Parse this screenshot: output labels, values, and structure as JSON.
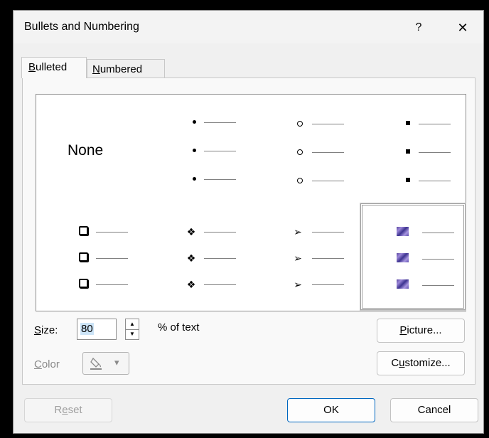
{
  "dialog": {
    "title": "Bullets and Numbering",
    "help_label": "?",
    "close_label": "✕"
  },
  "tabs": [
    {
      "label": "Bulleted",
      "accesskey": "B",
      "rest": "ulleted",
      "selected": true
    },
    {
      "label": "Numbered",
      "accesskey": "N",
      "rest": "umbered",
      "selected": false
    }
  ],
  "gallery": {
    "none_label": "None",
    "options": [
      {
        "id": "none",
        "glyph": ""
      },
      {
        "id": "dot",
        "glyph": "•"
      },
      {
        "id": "hollow-circle",
        "glyph": "○"
      },
      {
        "id": "filled-square",
        "glyph": "▪"
      },
      {
        "id": "hollow-square",
        "glyph": "❑"
      },
      {
        "id": "four-diamond",
        "glyph": "❖"
      },
      {
        "id": "arrowhead",
        "glyph": "➢"
      },
      {
        "id": "picture",
        "glyph": ""
      }
    ],
    "selected": "picture"
  },
  "size": {
    "label_accesskey": "S",
    "label_rest": "ize:",
    "value": "80",
    "suffix": "% of text"
  },
  "color": {
    "label_accesskey": "C",
    "label_rest": "olor",
    "icon": "paint-bucket-icon",
    "dropdown_icon": "chevron-down-icon",
    "arrow": "▾"
  },
  "buttons": {
    "picture_pre": "",
    "picture_key": "P",
    "picture_rest": "icture...",
    "customize_pre": "C",
    "customize_key": "u",
    "customize_rest": "stomize...",
    "reset_pre": "R",
    "reset_key": "e",
    "reset_rest": "set",
    "ok": "OK",
    "cancel": "Cancel"
  }
}
